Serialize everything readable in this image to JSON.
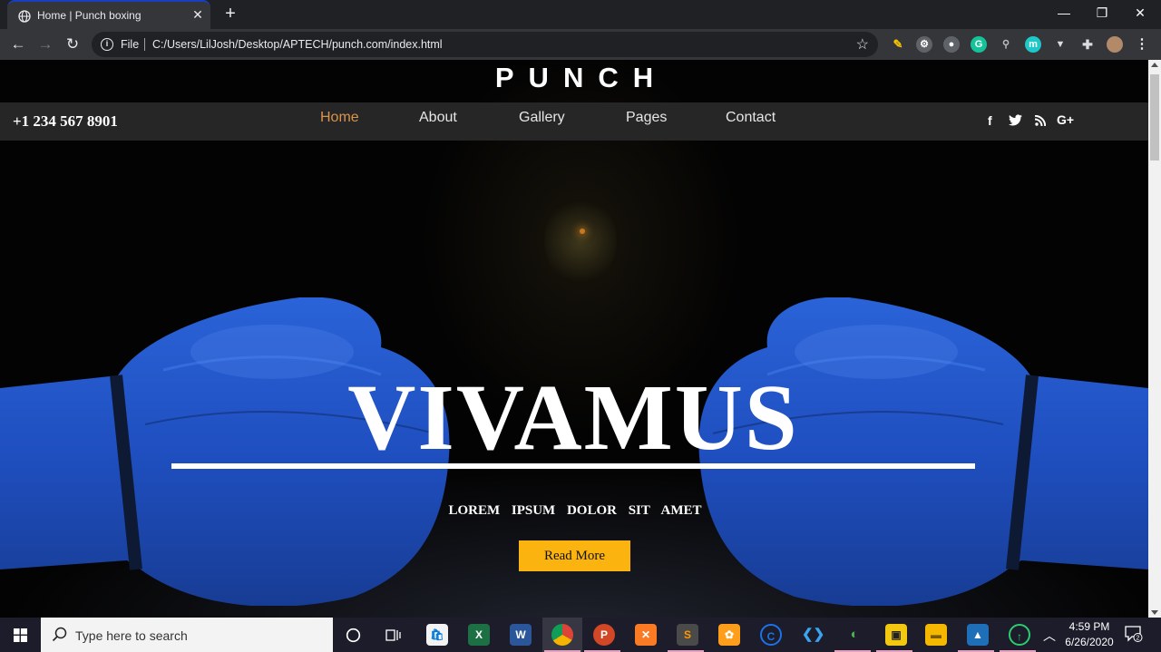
{
  "browser": {
    "tab_title": "Home | Punch boxing",
    "tab_close": "✕",
    "new_tab": "+",
    "omnibox_scheme": "File",
    "omnibox_url": "C:/Users/LilJosh/Desktop/APTECH/punch.com/index.html",
    "window_controls": {
      "minimize": "—",
      "restore": "❐",
      "close": "✕"
    }
  },
  "site": {
    "brand": "PUNCH",
    "phone": "+1 234 567 8901",
    "nav": [
      {
        "label": "Home",
        "active": true
      },
      {
        "label": "About",
        "active": false
      },
      {
        "label": "Gallery",
        "active": false
      },
      {
        "label": "Pages",
        "active": false
      },
      {
        "label": "Contact",
        "active": false
      }
    ],
    "social": {
      "facebook": "f",
      "twitter": "t",
      "rss": "rss",
      "googleplus": "G+"
    },
    "hero": {
      "headline": "VIVAMUS",
      "subtitle": "LOREM IPSUM DOLOR SIT AMET",
      "cta": "Read More"
    },
    "accent_color": "#d9944b",
    "cta_color": "#fbb40f"
  },
  "taskbar": {
    "search_placeholder": "Type here to search",
    "time": "4:59 PM",
    "date": "6/26/2020",
    "notification_count": "2"
  }
}
